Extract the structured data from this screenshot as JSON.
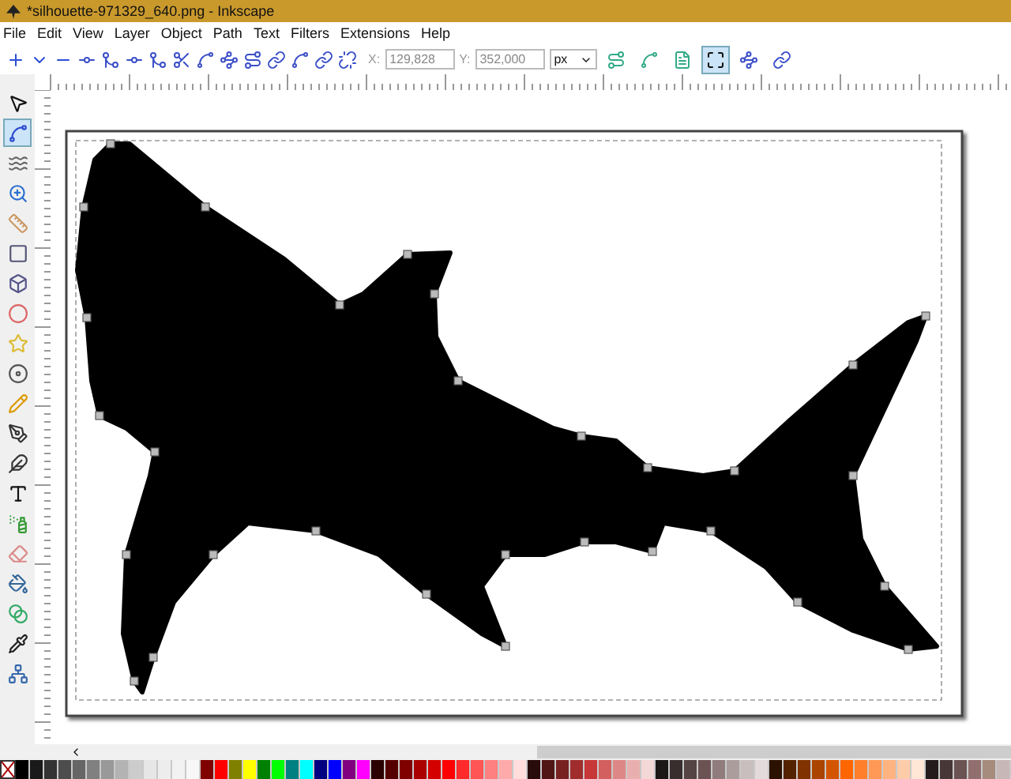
{
  "window": {
    "title": "*silhouette-971329_640.png - Inkscape"
  },
  "menu": [
    "File",
    "Edit",
    "View",
    "Layer",
    "Object",
    "Path",
    "Text",
    "Filters",
    "Extensions",
    "Help"
  ],
  "toolbar": {
    "x_label": "X:",
    "x_value": "129,828",
    "y_label": "Y:",
    "y_value": "352,000",
    "unit": "px",
    "toggles": [
      {
        "pressed": false
      },
      {
        "pressed": false
      },
      {
        "pressed": false
      },
      {
        "pressed": true
      },
      {
        "pressed": false
      },
      {
        "pressed": false
      }
    ]
  },
  "tools": [
    {
      "selected": false
    },
    {
      "selected": true
    },
    {
      "selected": false
    },
    {
      "selected": false
    },
    {
      "selected": false
    },
    {
      "selected": false
    },
    {
      "selected": false
    },
    {
      "selected": false
    },
    {
      "selected": false
    },
    {
      "selected": false
    },
    {
      "selected": false
    },
    {
      "selected": false
    },
    {
      "selected": false
    },
    {
      "selected": false
    },
    {
      "selected": false
    },
    {
      "selected": false
    },
    {
      "selected": false
    },
    {
      "selected": false
    },
    {
      "selected": false
    },
    {
      "selected": false
    }
  ]
}
